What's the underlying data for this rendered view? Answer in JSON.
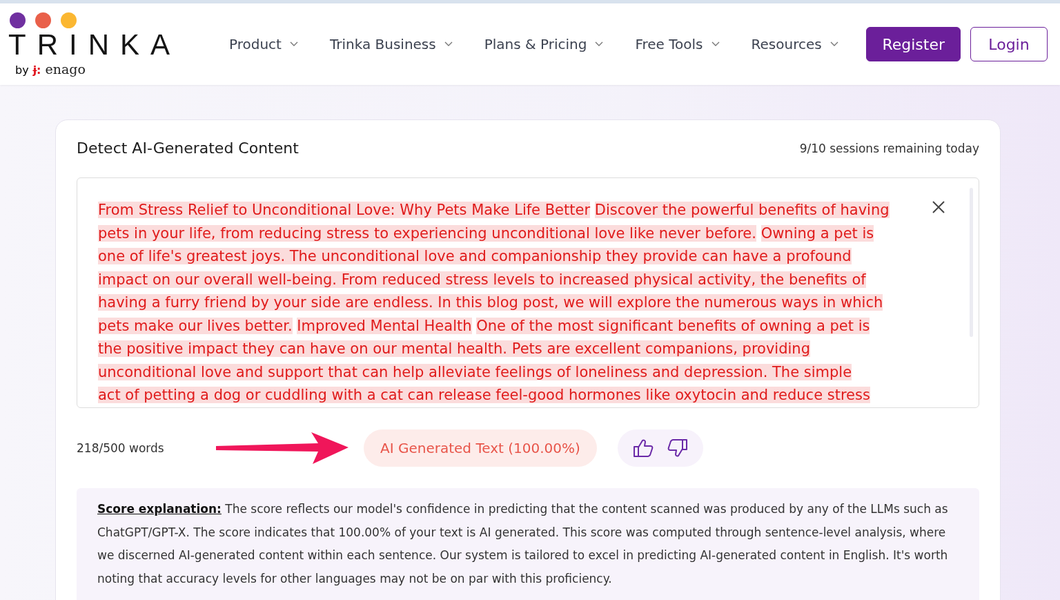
{
  "header": {
    "logo": {
      "wordmark": "TRINKA",
      "byline": "by",
      "brand": "enago",
      "brand_mark": "ɉ:"
    },
    "nav": [
      {
        "label": "Product"
      },
      {
        "label": "Trinka Business"
      },
      {
        "label": "Plans & Pricing"
      },
      {
        "label": "Free Tools"
      },
      {
        "label": "Resources"
      }
    ],
    "buttons": [
      {
        "label": "Register",
        "kind": "primary"
      },
      {
        "label": "Login",
        "kind": "outline"
      }
    ]
  },
  "detector": {
    "title": "Detect AI-Generated Content",
    "sessions": "9/10 sessions remaining today",
    "lines": [
      [
        {
          "text": "From Stress Relief to Unconditional Love: Why Pets Make Life Better",
          "ai_generated": true
        },
        {
          "text": "Discover the powerful benefits of having",
          "ai_generated": true
        }
      ],
      [
        {
          "text": "pets in your life, from reducing stress to experiencing unconditional love like never before.",
          "ai_generated": true
        },
        {
          "text": "Owning a pet is",
          "ai_generated": true
        }
      ],
      [
        {
          "text": "one of life's greatest joys. The unconditional love and companionship they provide can have a profound",
          "ai_generated": true
        }
      ],
      [
        {
          "text": "impact on our overall well-being. From reduced stress levels to increased physical activity, the benefits of",
          "ai_generated": true
        }
      ],
      [
        {
          "text": "having a furry friend by your side are endless. In this blog post, we will explore the numerous ways in which",
          "ai_generated": true
        }
      ],
      [
        {
          "text": "pets make our lives better.",
          "ai_generated": true
        },
        {
          "text": "Improved Mental Health",
          "ai_generated": true
        },
        {
          "text": "One of the most significant benefits of owning a pet is",
          "ai_generated": true
        }
      ],
      [
        {
          "text": "the positive impact they can have on our mental health. Pets are excellent companions, providing",
          "ai_generated": true
        }
      ],
      [
        {
          "text": "unconditional love and support that can help alleviate feelings of loneliness and depression. The simple",
          "ai_generated": true
        }
      ],
      [
        {
          "text": "act of petting a dog or cuddling with a cat can release feel-good hormones like oxytocin and reduce stress",
          "ai_generated": true
        }
      ]
    ],
    "word_count": "218/500 words",
    "result": "AI Generated Text (100.00%)",
    "explanation": "**Score explanation:** The score reflects our model's confidence in predicting that the content scanned was produced by any of the LLMs such as ChatGPT/GPT-X. The score indicates that 100.00% of your text is AI generated. This score was computed through sentence-level analysis, where we discerned AI-generated content within each sentence. Our system is tailored to excel in predicting AI-generated content in English. It's worth noting that accuracy levels for other languages may not be on par with this proficiency."
  }
}
